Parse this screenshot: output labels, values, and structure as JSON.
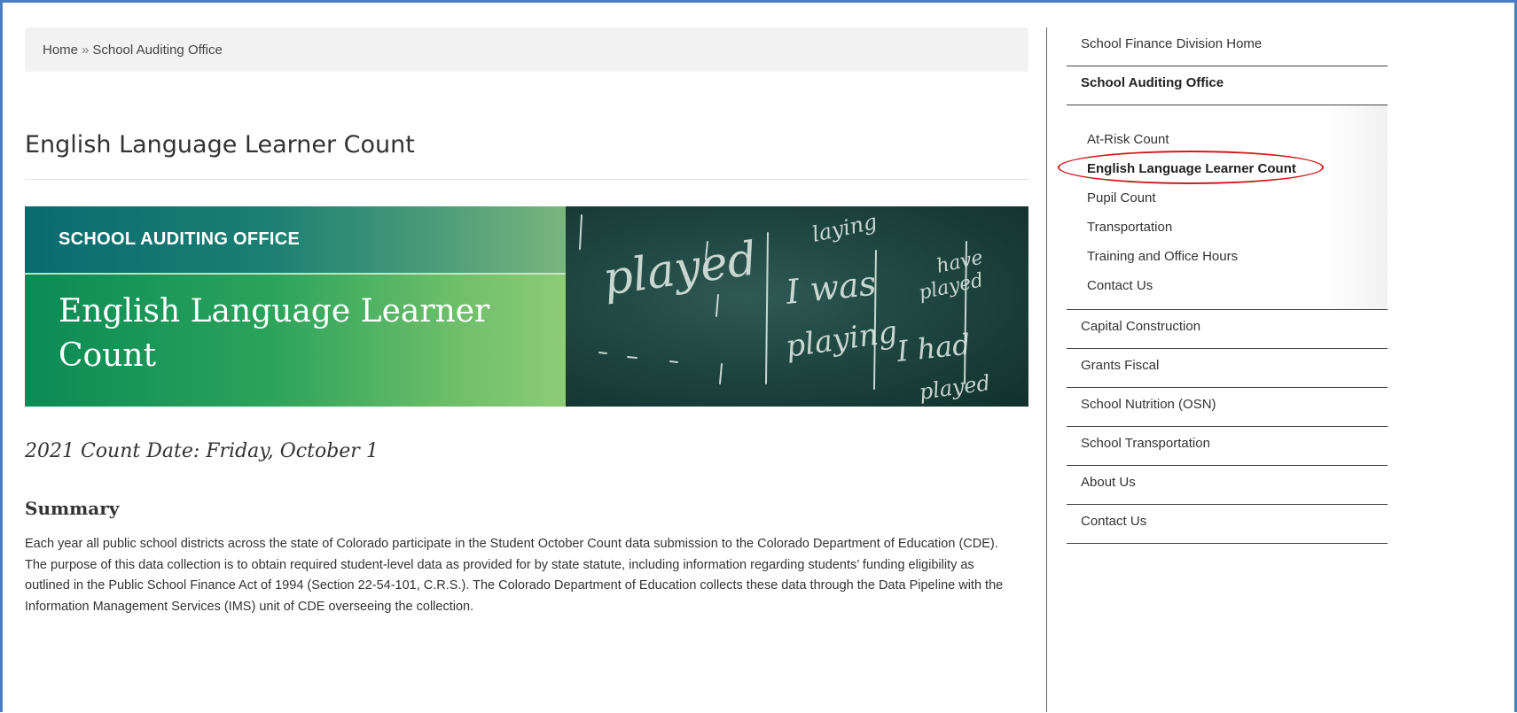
{
  "breadcrumb": {
    "home": "Home",
    "separator": "»",
    "current": "School Auditing Office"
  },
  "page": {
    "title": "English Language Learner Count"
  },
  "banner": {
    "kicker": "SCHOOL AUDITING OFFICE",
    "headline": "English Language Learner Count",
    "chalkboard_words": [
      "played",
      "I was",
      "playing",
      "I had",
      "played",
      "have",
      "played",
      "laying"
    ]
  },
  "count_date": "2021 Count Date: Friday, October 1",
  "summary": {
    "heading": "Summary",
    "text": "Each year all public school districts across the state of Colorado participate in the Student October Count data submission to the Colorado Department of Education (CDE). The purpose of this data collection is to obtain required student-level data as provided for by state statute, including information regarding students’ funding eligibility as outlined in the Public School Finance Act of 1994 (Section 22-54-101, C.R.S.). The Colorado Department of Education collects these data through the Data Pipeline with the Information Management Services (IMS) unit of CDE overseeing the collection."
  },
  "sidebar": {
    "top_items": [
      "School Finance Division Home",
      "School Auditing Office"
    ],
    "sub_items": [
      "At-Risk Count",
      "English Language Learner Count",
      "Pupil Count",
      "Transportation",
      "Training and Office Hours",
      "Contact Us"
    ],
    "bottom_items": [
      "Capital Construction",
      "Grants Fiscal",
      "School Nutrition (OSN)",
      "School Transportation",
      "About Us",
      "Contact Us"
    ]
  },
  "colors": {
    "frame_border": "#4a7fbf",
    "highlight_circle": "#d21a1a",
    "banner_green": "#2aa35b",
    "banner_teal": "#0a6b6f"
  }
}
